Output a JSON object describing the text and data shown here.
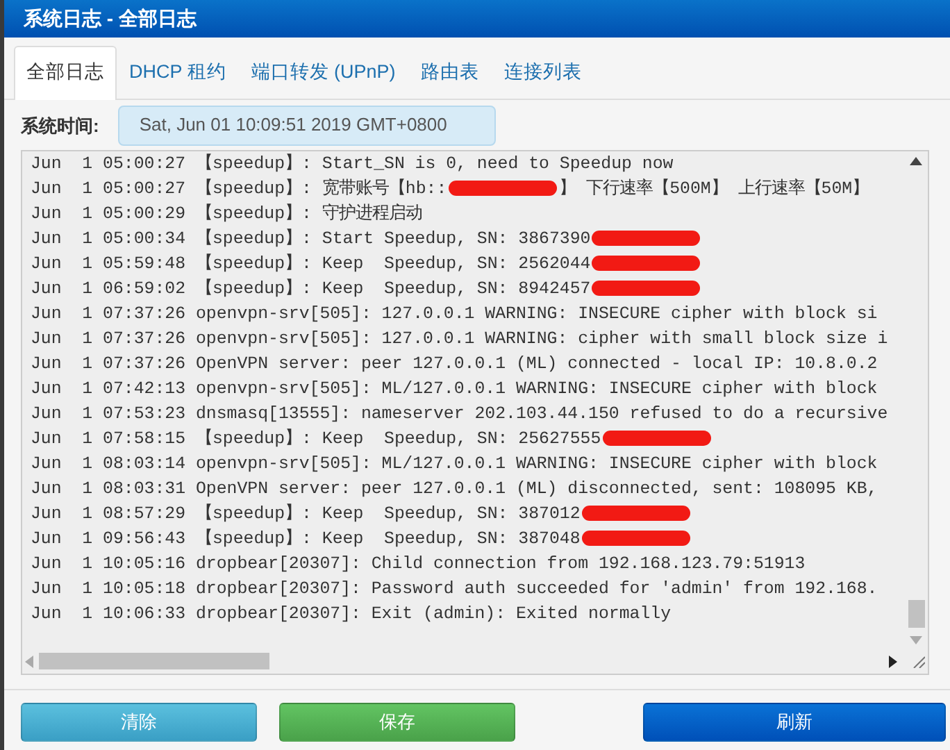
{
  "window": {
    "title": "系统日志 - 全部日志"
  },
  "tabs": [
    {
      "label": "全部日志",
      "selected": true
    },
    {
      "label": "DHCP 租约",
      "selected": false
    },
    {
      "label": "端口转发 (UPnP)",
      "selected": false
    },
    {
      "label": "路由表",
      "selected": false
    },
    {
      "label": "连接列表",
      "selected": false
    }
  ],
  "system_time": {
    "label": "系统时间:",
    "value": "Sat, Jun 01 10:09:51 2019 GMT+0800"
  },
  "log": [
    {
      "text": "Jun  1 05:00:27 【speedup】: Start_SN is 0, need to Speedup now",
      "redacted": false
    },
    {
      "text": "Jun  1 05:00:27 【speedup】: 宽带账号【hb::",
      "redacted": true,
      "after": "】 下行速率【500M】 上行速率【50M】"
    },
    {
      "text": "Jun  1 05:00:29 【speedup】: 守护进程启动",
      "redacted": false
    },
    {
      "text": "Jun  1 05:00:34 【speedup】: Start Speedup, SN: 3867390",
      "redacted": true
    },
    {
      "text": "Jun  1 05:59:48 【speedup】: Keep  Speedup, SN: 2562044",
      "redacted": true
    },
    {
      "text": "Jun  1 06:59:02 【speedup】: Keep  Speedup, SN: 8942457",
      "redacted": true
    },
    {
      "text": "Jun  1 07:37:26 openvpn-srv[505]: 127.0.0.1 WARNING: INSECURE cipher with block si",
      "redacted": false
    },
    {
      "text": "Jun  1 07:37:26 openvpn-srv[505]: 127.0.0.1 WARNING: cipher with small block size i",
      "redacted": false
    },
    {
      "text": "Jun  1 07:37:26 OpenVPN server: peer 127.0.0.1 (ML) connected - local IP: 10.8.0.2",
      "redacted": false
    },
    {
      "text": "Jun  1 07:42:13 openvpn-srv[505]: ML/127.0.0.1 WARNING: INSECURE cipher with block",
      "redacted": false
    },
    {
      "text": "Jun  1 07:53:23 dnsmasq[13555]: nameserver 202.103.44.150 refused to do a recursive",
      "redacted": false
    },
    {
      "text": "Jun  1 07:58:15 【speedup】: Keep  Speedup, SN: 25627555",
      "redacted": true
    },
    {
      "text": "Jun  1 08:03:14 openvpn-srv[505]: ML/127.0.0.1 WARNING: INSECURE cipher with block",
      "redacted": false
    },
    {
      "text": "Jun  1 08:03:31 OpenVPN server: peer 127.0.0.1 (ML) disconnected, sent: 108095 KB,",
      "redacted": false
    },
    {
      "text": "Jun  1 08:57:29 【speedup】: Keep  Speedup, SN: 387012",
      "redacted": true
    },
    {
      "text": "Jun  1 09:56:43 【speedup】: Keep  Speedup, SN: 387048",
      "redacted": true
    },
    {
      "text": "Jun  1 10:05:16 dropbear[20307]: Child connection from 192.168.123.79:51913",
      "redacted": false
    },
    {
      "text": "Jun  1 10:05:18 dropbear[20307]: Password auth succeeded for 'admin' from 192.168.",
      "redacted": false
    },
    {
      "text": "Jun  1 10:06:33 dropbear[20307]: Exit (admin): Exited normally",
      "redacted": false
    }
  ],
  "buttons": [
    {
      "label": "清除",
      "kind": "info"
    },
    {
      "label": "保存",
      "kind": "success"
    },
    {
      "label": "刷新",
      "kind": "primary"
    }
  ]
}
